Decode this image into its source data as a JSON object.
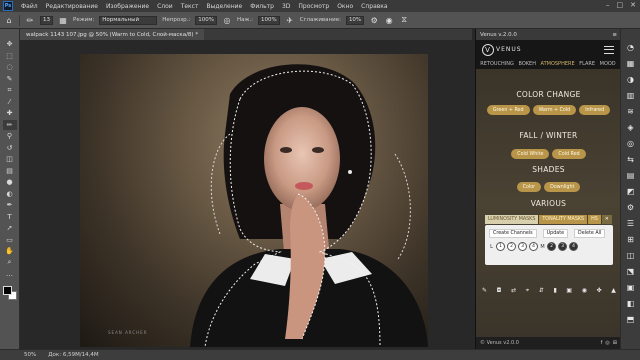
{
  "menubar": {
    "logo": "Ps",
    "items": [
      "Файл",
      "Редактирование",
      "Изображение",
      "Слои",
      "Текст",
      "Выделение",
      "Фильтр",
      "3D",
      "Просмотр",
      "Окно",
      "Справка"
    ],
    "window_controls": [
      "–",
      "□",
      "✕"
    ]
  },
  "options": {
    "brush_size": "13",
    "mode_label": "Режим:",
    "mode_value": "Нормальный",
    "opacity_label": "Непрозр.:",
    "opacity_value": "100%",
    "pressure_label": "Наж.:",
    "pressure_value": "100%",
    "smoothing_label": "Сглаживание:",
    "smoothing_value": "10%"
  },
  "document": {
    "tab_title": "walpack 1143 107.jpg @ 50% (Warm to Cold, Слой-маска/8) *",
    "watermark": "SEAN ARCHER"
  },
  "toolbar": {
    "tools": [
      "move-icon",
      "marquee-icon",
      "lasso-icon",
      "quick-select-icon",
      "crop-icon",
      "eyedropper-icon",
      "healing-icon",
      "brush-icon",
      "stamp-icon",
      "history-brush-icon",
      "eraser-icon",
      "gradient-icon",
      "blur-icon",
      "dodge-icon",
      "pen-icon",
      "type-icon",
      "path-select-icon",
      "shape-icon",
      "hand-icon",
      "zoom-icon",
      "more-icon"
    ],
    "glyphs": [
      "✥",
      "⬚",
      "◌",
      "✎",
      "⌗",
      "⁄",
      "✚",
      "✏",
      "⚲",
      "↺",
      "◫",
      "▤",
      "●",
      "◐",
      "✒",
      "T",
      "➚",
      "▭",
      "✋",
      "⌕",
      "…"
    ],
    "active_index": 7,
    "foreground_color": "#000000",
    "background_color": "#ffffff"
  },
  "panel": {
    "title": "Venus v.2.0.0",
    "brand": "VENUS",
    "tabs": [
      "RETOUCHING",
      "BOKEH",
      "ATMOSPHERE",
      "FLARE",
      "MOOD"
    ],
    "active_tab": 2,
    "accent_color": "#b89549",
    "sections": {
      "color_change": {
        "title": "COLOR CHANGE",
        "buttons": [
          "Green + Red",
          "Warm + Cold",
          "Infrared"
        ]
      },
      "fall_winter": {
        "title": "FALL / WINTER",
        "buttons": [
          "Cold White",
          "Cold Red"
        ]
      },
      "shades": {
        "title": "SHADES",
        "buttons": [
          "Color",
          "Downlight"
        ]
      },
      "various": {
        "title": "VARIOUS"
      }
    },
    "mask_tabs": [
      "LUMINOSITY MASKS",
      "TONALITY MASKS",
      "HS",
      "✕"
    ],
    "mask_buttons": [
      "Create Channels",
      "Update",
      "Delete All"
    ],
    "mask_left": "L",
    "mask_right": "M",
    "mask_numbers_left": [
      "1",
      "2",
      "3",
      "4"
    ],
    "mask_numbers_right": [
      "2",
      "3",
      "4"
    ],
    "tool_icons": [
      "✎",
      "◘",
      "⇄",
      "⌖",
      "⇵",
      "▮",
      "▣",
      "◉",
      "✤",
      "▲"
    ],
    "footer_text": "© Venus v2.0.0",
    "footer_icons": [
      "f",
      "◎",
      "⊞"
    ]
  },
  "right_dock": {
    "icons": [
      "◔",
      "▦",
      "◑",
      "▥",
      "≋",
      "◈",
      "◎",
      "⇆",
      "▤",
      "◩",
      "⚙",
      "☰",
      "⊞",
      "◫",
      "⬔",
      "▣",
      "◧",
      "⬒"
    ]
  },
  "statusbar": {
    "zoom": "50%",
    "doc_info": "Док: 6,59M/14,4M"
  }
}
